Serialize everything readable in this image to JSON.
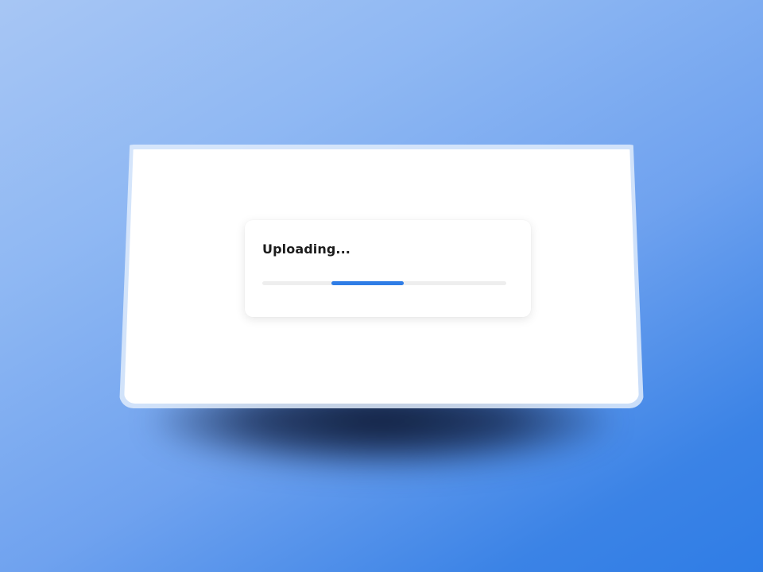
{
  "upload": {
    "title": "Uploading...",
    "progress_indicator": "indeterminate"
  },
  "colors": {
    "accent": "#2f7de6",
    "track": "#eeeeee",
    "background_top": "#a7c6f4",
    "background_bottom": "#2f7de6"
  }
}
